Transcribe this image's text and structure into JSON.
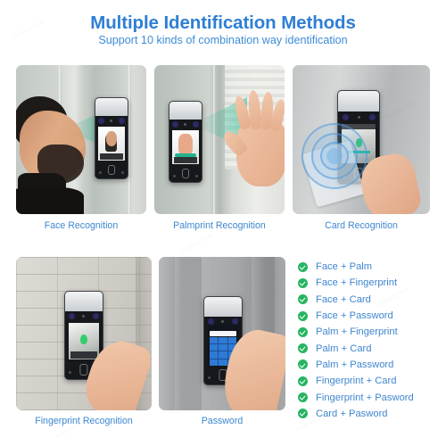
{
  "header": {
    "title": "Multiple Identification Methods",
    "subtitle": "Support 10 kinds of combination way identification",
    "title_color": "#2e7fd4",
    "subtitle_color": "#3e8cd8"
  },
  "panels": [
    {
      "id": "face",
      "caption": "Face Recognition",
      "scene": "man-profile-facing-wall-terminal",
      "beam_color": "#24ba92"
    },
    {
      "id": "palm",
      "caption": "Palmprint Recognition",
      "scene": "open-hand-toward-terminal",
      "beam_color": "#24ba92"
    },
    {
      "id": "card",
      "caption": "Card Recognition",
      "scene": "hand-tapping-rfid-card",
      "beam_color": "#4a98dd"
    },
    {
      "id": "finger",
      "caption": "Fingerprint Recognition",
      "scene": "finger-on-sensor-brick-wall",
      "beam_color": "#35cc6d"
    },
    {
      "id": "pass",
      "caption": "Password",
      "scene": "finger-on-numeric-keypad",
      "beam_color": "#2f7ad4"
    }
  ],
  "combinations": {
    "check_color": "#27b463",
    "label_color": "#3f86cf",
    "items": [
      "Face + Palm",
      "Face + Fingerprint",
      "Face + Card",
      "Face + Password",
      "Palm + Fingerprint",
      "Palm + Card",
      "Palm + Password",
      "Fingerprint + Card",
      "Fingerprint + Pasword",
      "Card + Pasword"
    ]
  },
  "keypad_keys": [
    "1",
    "2",
    "3",
    "4",
    "5",
    "6",
    "7",
    "8",
    "9",
    "",
    "0",
    ""
  ]
}
